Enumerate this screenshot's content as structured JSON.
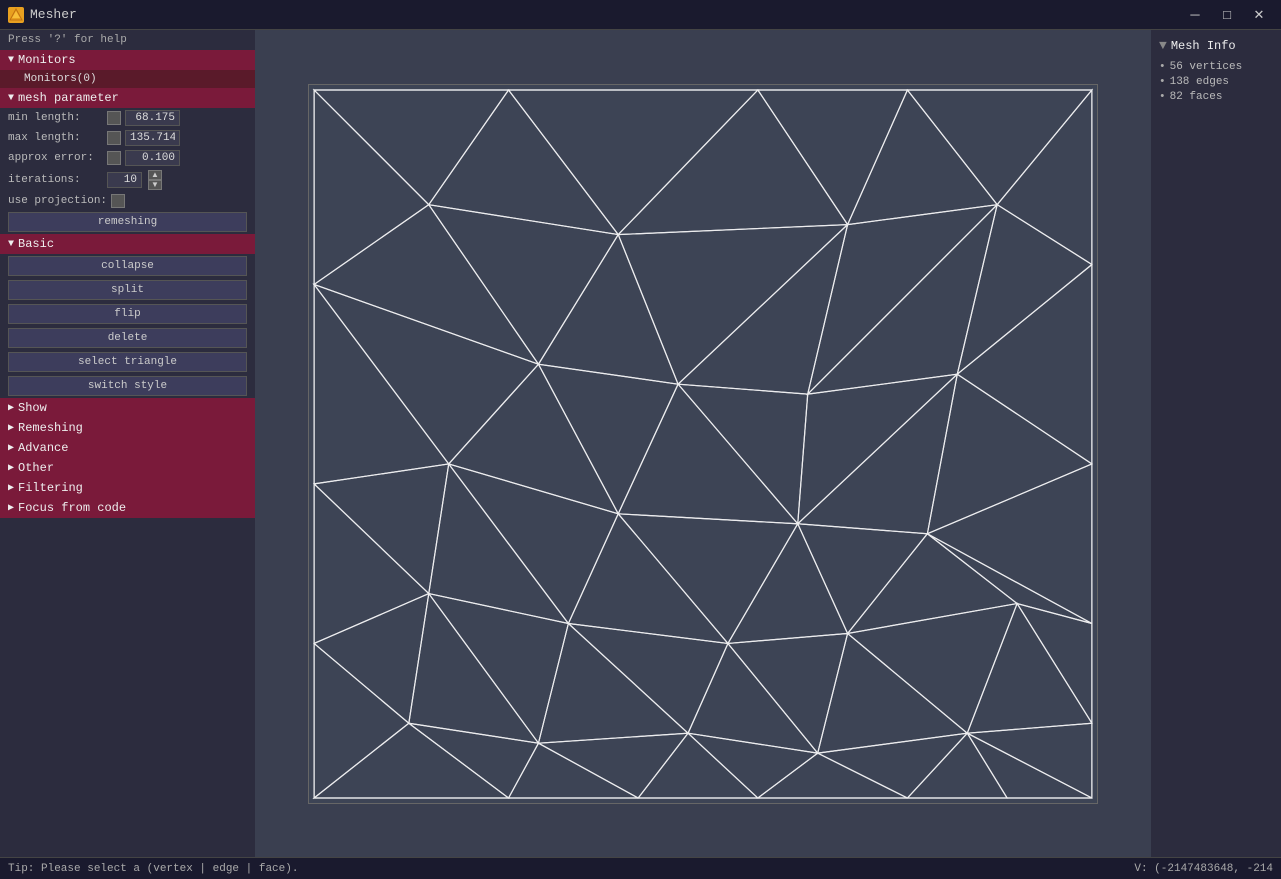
{
  "app": {
    "title": "Mesher",
    "icon": "M"
  },
  "titlebar": {
    "minimize": "─",
    "maximize": "□",
    "close": "✕"
  },
  "hint": "Press '?' for help",
  "monitors": {
    "label": "Monitors",
    "sub_label": "Monitors(0)"
  },
  "mesh_param": {
    "label": "mesh parameter",
    "min_length_label": "min length:",
    "min_length_value": "68.175",
    "max_length_label": "max length:",
    "max_length_value": "135.714",
    "approx_error_label": "approx error:",
    "approx_error_value": "0.100",
    "iterations_label": "iterations:",
    "iterations_value": "10",
    "use_projection_label": "use projection:",
    "remeshing_btn": "remeshing"
  },
  "basic": {
    "label": "Basic",
    "collapse_btn": "collapse",
    "split_btn": "split",
    "flip_btn": "flip",
    "delete_btn": "delete",
    "select_triangle_btn": "select triangle",
    "switch_style_btn": "switch style"
  },
  "collapsed_sections": [
    {
      "id": "show",
      "label": "Show"
    },
    {
      "id": "remeshing",
      "label": "Remeshing"
    },
    {
      "id": "advance",
      "label": "Advance"
    },
    {
      "id": "other",
      "label": "Other"
    },
    {
      "id": "filtering",
      "label": "Filtering"
    },
    {
      "id": "focus-from-code",
      "label": "Focus from code"
    }
  ],
  "mesh_info": {
    "header": "Mesh Info",
    "vertices": "56 vertices",
    "edges": "138 edges",
    "faces": "82 faces"
  },
  "statusbar": {
    "tip": "Tip: Please select a (vertex | edge | face).",
    "coords": "V: (-2147483648, -214"
  }
}
